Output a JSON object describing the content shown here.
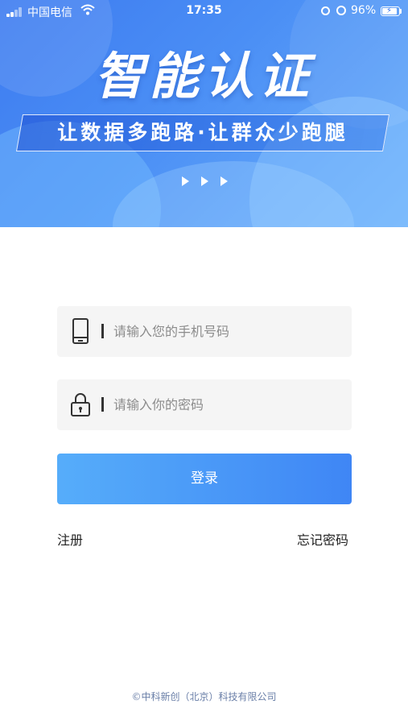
{
  "status_bar": {
    "carrier": "中国电信",
    "time": "17:35",
    "battery_percent": "96%",
    "battery_level": 0.96
  },
  "banner": {
    "title": "智能认证",
    "slogan": "让数据多跑路·让群众少跑腿",
    "colors": {
      "start": "#3d7bf0",
      "end": "#6cb0fb"
    }
  },
  "form": {
    "phone_placeholder": "请输入您的手机号码",
    "phone_icon": "mobile-phone-icon",
    "password_placeholder": "请输入你的密码",
    "password_icon": "padlock-icon",
    "login_label": "登录",
    "register_label": "注册",
    "forgot_label": "忘记密码"
  },
  "footer": {
    "copyright": "©中科新创（北京）科技有限公司"
  },
  "colors": {
    "accent": "#3f86f5",
    "field_bg": "#f5f5f5"
  }
}
